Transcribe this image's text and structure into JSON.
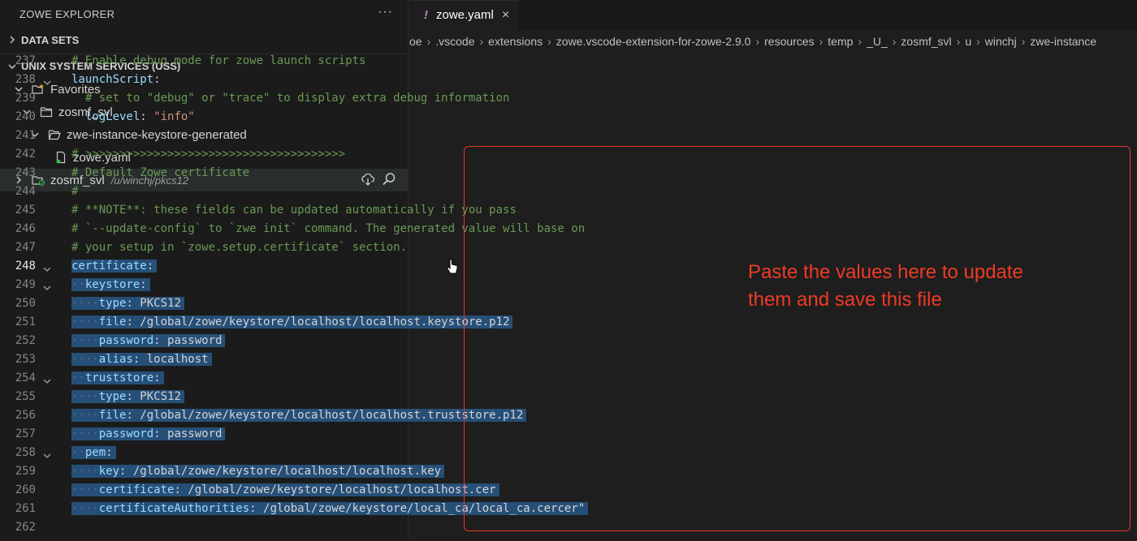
{
  "sidebar": {
    "title": "ZOWE EXPLORER",
    "more_label": "···",
    "sections": [
      {
        "label": "DATA SETS",
        "expanded": false
      },
      {
        "label": "UNIX SYSTEM SERVICES (USS)",
        "expanded": true
      }
    ],
    "tree": [
      {
        "label": "Favorites",
        "level": 1,
        "icon": "favorites-folder-icon",
        "expanded": true
      },
      {
        "label": "zosmf_svl",
        "level": 2,
        "icon": "folder-icon",
        "expanded": true
      },
      {
        "label": "zwe-instance-keystore-generated",
        "level": 3,
        "icon": "folder-open-icon",
        "expanded": true
      },
      {
        "label": "zowe.yaml",
        "level": 4,
        "icon": "file-icon"
      },
      {
        "label": "zosmf_svl",
        "path": "/u/winchj/pkcs12",
        "level": 1,
        "icon": "profile-folder-icon",
        "expanded": false,
        "selected": true
      }
    ]
  },
  "editor": {
    "tab": {
      "label": "zowe.yaml",
      "modified_glyph": "!",
      "close_glyph": "×"
    },
    "breadcrumb": [
      "oe",
      ".vscode",
      "extensions",
      "zowe.vscode-extension-for-zowe-2.9.0",
      "resources",
      "temp",
      "_U_",
      "zosmf_svl",
      "u",
      "winchj",
      "zwe-instance"
    ],
    "lines": [
      {
        "n": "237",
        "indent": 0,
        "parts": [
          {
            "t": "# Enable debug mode for zowe launch scripts",
            "c": "cm"
          }
        ]
      },
      {
        "n": "238",
        "indent": 0,
        "fold": true,
        "parts": [
          {
            "t": "launchScript",
            "c": "key"
          },
          {
            "t": ":",
            "c": "plain"
          }
        ]
      },
      {
        "n": "239",
        "indent": 1,
        "parts": [
          {
            "t": "# set to \"debug\" or \"trace\" to display extra debug information",
            "c": "cm"
          }
        ]
      },
      {
        "n": "240",
        "indent": 1,
        "parts": [
          {
            "t": "logLevel",
            "c": "key"
          },
          {
            "t": ": ",
            "c": "plain"
          },
          {
            "t": "\"info\"",
            "c": "str"
          }
        ]
      },
      {
        "n": "241",
        "indent": 0,
        "parts": []
      },
      {
        "n": "242",
        "indent": 0,
        "parts": [
          {
            "t": "# >>>>>>>>>>>>>>>>>>>>>>>>>>>>>>>>>>>>>>",
            "c": "cm"
          }
        ]
      },
      {
        "n": "243",
        "indent": 0,
        "parts": [
          {
            "t": "# Default Zowe certificate",
            "c": "cm"
          }
        ]
      },
      {
        "n": "244",
        "indent": 0,
        "parts": [
          {
            "t": "#",
            "c": "cm"
          }
        ]
      },
      {
        "n": "245",
        "indent": 0,
        "parts": [
          {
            "t": "# **NOTE**: these fields can be updated automatically if you pass",
            "c": "cm"
          }
        ]
      },
      {
        "n": "246",
        "indent": 0,
        "parts": [
          {
            "t": "# `--update-config` to `zwe init` command. The generated value will base on",
            "c": "cm"
          }
        ]
      },
      {
        "n": "247",
        "indent": 0,
        "parts": [
          {
            "t": "# your setup in `zowe.setup.certificate` section.",
            "c": "cm"
          }
        ]
      },
      {
        "n": "248",
        "indent": 0,
        "fold": true,
        "sel": true,
        "active": true,
        "parts": [
          {
            "t": "certificate",
            "c": "key"
          },
          {
            "t": ":",
            "c": "plain"
          }
        ]
      },
      {
        "n": "249",
        "indent": 1,
        "fold": true,
        "sel": true,
        "parts": [
          {
            "t": "keystore",
            "c": "key"
          },
          {
            "t": ":",
            "c": "plain"
          }
        ]
      },
      {
        "n": "250",
        "indent": 2,
        "sel": true,
        "parts": [
          {
            "t": "type",
            "c": "key"
          },
          {
            "t": ": ",
            "c": "plain"
          },
          {
            "t": "PKCS12",
            "c": "plain"
          }
        ]
      },
      {
        "n": "251",
        "indent": 2,
        "sel": true,
        "parts": [
          {
            "t": "file",
            "c": "key"
          },
          {
            "t": ": ",
            "c": "plain"
          },
          {
            "t": "/global/zowe/keystore/localhost/localhost.keystore.p12",
            "c": "plain"
          }
        ]
      },
      {
        "n": "252",
        "indent": 2,
        "sel": true,
        "parts": [
          {
            "t": "password",
            "c": "key"
          },
          {
            "t": ": ",
            "c": "plain"
          },
          {
            "t": "password",
            "c": "plain"
          }
        ]
      },
      {
        "n": "253",
        "indent": 2,
        "sel": true,
        "parts": [
          {
            "t": "alias",
            "c": "key"
          },
          {
            "t": ": ",
            "c": "plain"
          },
          {
            "t": "localhost",
            "c": "plain"
          }
        ]
      },
      {
        "n": "254",
        "indent": 1,
        "fold": true,
        "sel": true,
        "parts": [
          {
            "t": "truststore",
            "c": "key"
          },
          {
            "t": ":",
            "c": "plain"
          }
        ]
      },
      {
        "n": "255",
        "indent": 2,
        "sel": true,
        "parts": [
          {
            "t": "type",
            "c": "key"
          },
          {
            "t": ": ",
            "c": "plain"
          },
          {
            "t": "PKCS12",
            "c": "plain"
          }
        ]
      },
      {
        "n": "256",
        "indent": 2,
        "sel": true,
        "parts": [
          {
            "t": "file",
            "c": "key"
          },
          {
            "t": ": ",
            "c": "plain"
          },
          {
            "t": "/global/zowe/keystore/localhost/localhost.truststore.p12",
            "c": "plain"
          }
        ]
      },
      {
        "n": "257",
        "indent": 2,
        "sel": true,
        "parts": [
          {
            "t": "password",
            "c": "key"
          },
          {
            "t": ": ",
            "c": "plain"
          },
          {
            "t": "password",
            "c": "plain"
          }
        ]
      },
      {
        "n": "258",
        "indent": 1,
        "fold": true,
        "sel": true,
        "parts": [
          {
            "t": "pem",
            "c": "key"
          },
          {
            "t": ":",
            "c": "plain"
          }
        ]
      },
      {
        "n": "259",
        "indent": 2,
        "sel": true,
        "parts": [
          {
            "t": "key",
            "c": "key"
          },
          {
            "t": ": ",
            "c": "plain"
          },
          {
            "t": "/global/zowe/keystore/localhost/localhost.key",
            "c": "plain"
          }
        ]
      },
      {
        "n": "260",
        "indent": 2,
        "sel": true,
        "parts": [
          {
            "t": "certificate",
            "c": "key"
          },
          {
            "t": ": ",
            "c": "plain"
          },
          {
            "t": "/global/zowe/keystore/localhost/localhost.cer",
            "c": "plain"
          }
        ]
      },
      {
        "n": "261",
        "indent": 2,
        "sel": true,
        "parts": [
          {
            "t": "certificateAuthorities",
            "c": "key"
          },
          {
            "t": ": ",
            "c": "plain"
          },
          {
            "t": "/global/zowe/keystore/local_ca/local_ca.cercer\"",
            "c": "plain"
          }
        ]
      },
      {
        "n": "262",
        "indent": 0,
        "parts": []
      }
    ]
  },
  "annotation": {
    "text_line1": "Paste the values here to update",
    "text_line2": "them and save this file",
    "color": "#ee3b25"
  }
}
